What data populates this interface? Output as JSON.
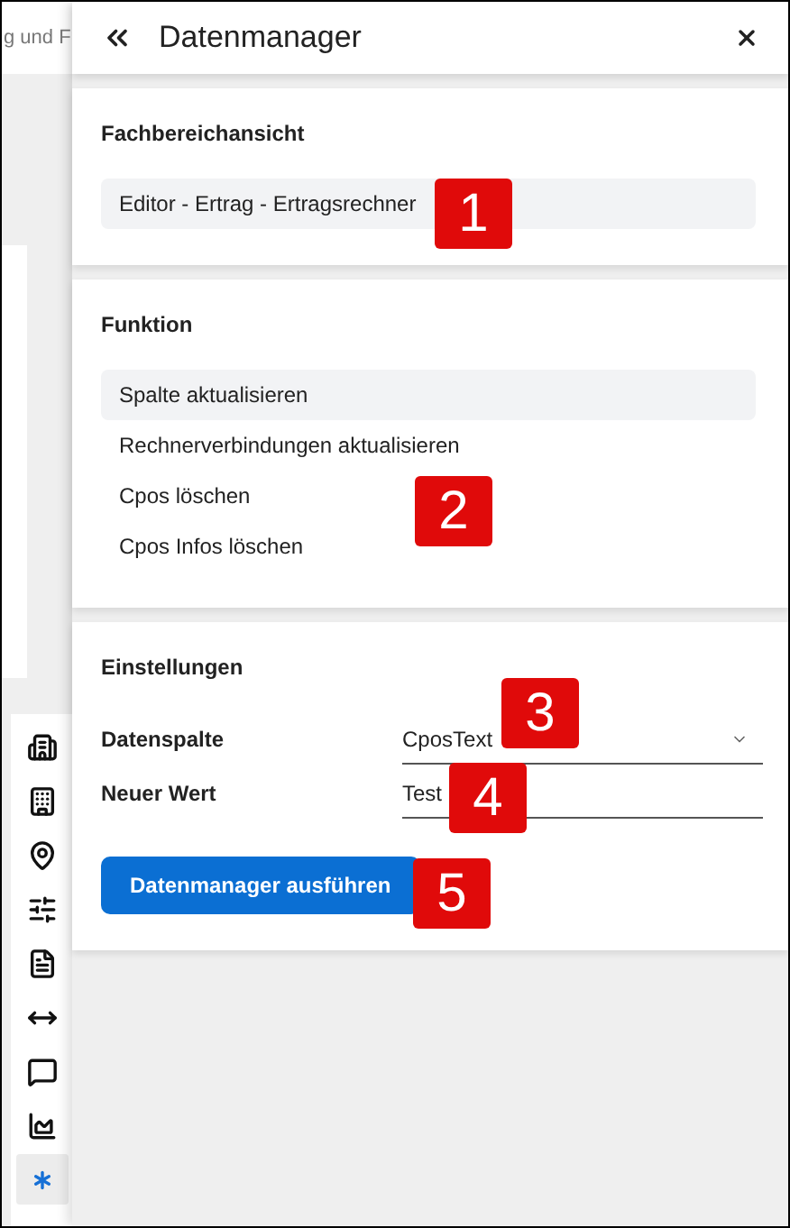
{
  "background_app": {
    "header_text": "g und F"
  },
  "side_toolbar": {
    "items": [
      {
        "kind": "buildings",
        "selected": false
      },
      {
        "kind": "building",
        "selected": false
      },
      {
        "kind": "pin",
        "selected": false
      },
      {
        "kind": "sliders",
        "selected": false
      },
      {
        "kind": "document",
        "selected": false
      },
      {
        "kind": "arrows",
        "selected": false
      },
      {
        "kind": "comment",
        "selected": false
      },
      {
        "kind": "chart",
        "selected": false
      },
      {
        "kind": "asterisk",
        "selected": true
      }
    ]
  },
  "panel": {
    "title": "Datenmanager",
    "sections": [
      {
        "kind": "list",
        "title": "Fachbereichansicht",
        "items": [
          {
            "label": "Editor - Ertrag - Ertragsrechner",
            "selected": true
          }
        ]
      },
      {
        "kind": "list",
        "title": "Funktion",
        "items": [
          {
            "label": "Spalte aktualisieren",
            "selected": true
          },
          {
            "label": "Rechnerverbindungen aktualisieren",
            "selected": false
          },
          {
            "label": "Cpos löschen",
            "selected": false
          },
          {
            "label": "Cpos Infos löschen",
            "selected": false
          }
        ]
      },
      {
        "kind": "form",
        "title": "Einstellungen",
        "fields": [
          {
            "kind": "select",
            "label": "Datenspalte",
            "value": "CposText"
          },
          {
            "kind": "text",
            "label": "Neuer Wert",
            "value": "Test"
          }
        ],
        "button": "Datenmanager ausführen"
      }
    ]
  },
  "callouts": [
    "1",
    "2",
    "3",
    "4",
    "5"
  ]
}
